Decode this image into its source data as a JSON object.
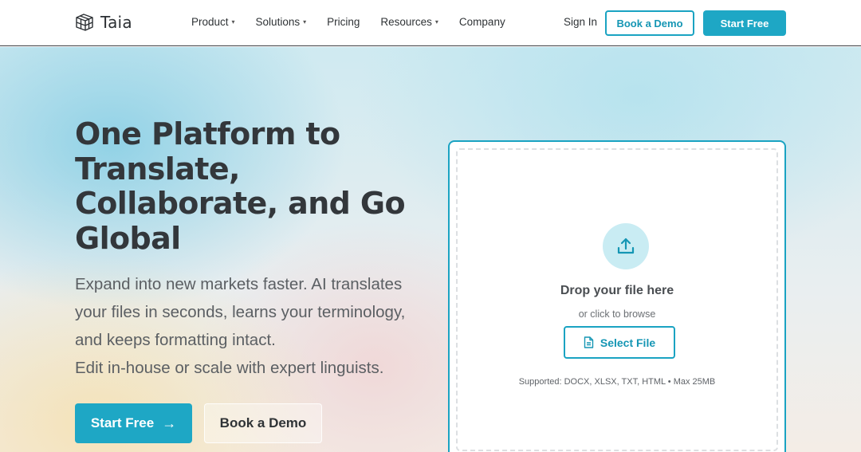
{
  "brand": {
    "name": "Taia",
    "logo_icon": "cube-logo-icon"
  },
  "nav": {
    "items": [
      {
        "label": "Product",
        "has_dropdown": true
      },
      {
        "label": "Solutions",
        "has_dropdown": true
      },
      {
        "label": "Pricing",
        "has_dropdown": false
      },
      {
        "label": "Resources",
        "has_dropdown": true
      },
      {
        "label": "Company",
        "has_dropdown": false
      }
    ],
    "caret": "▾",
    "sign_in": "Sign In",
    "book_demo": "Book a Demo",
    "start_free": "Start Free"
  },
  "hero": {
    "headline": "One Platform to Translate, Collaborate, and Go Global",
    "sub_line1": "Expand into new markets faster. AI translates your files in seconds, learns your terminology, and keeps formatting intact.",
    "sub_line2": "Edit in-house or scale with expert linguists.",
    "start_free": "Start Free",
    "start_free_arrow": "→",
    "book_demo": "Book a Demo"
  },
  "upload": {
    "icon": "upload-icon",
    "title": "Drop your file here",
    "subtitle": "or click to browse",
    "button_label": "Select File",
    "button_icon": "file-icon",
    "supported": "Supported: DOCX, XLSX, TXT, HTML • Max 25MB"
  },
  "colors": {
    "accent": "#1ea7c5",
    "accent_dark": "#1596b4",
    "text_dark": "#33373b",
    "upload_circle": "#c9ecf3"
  }
}
